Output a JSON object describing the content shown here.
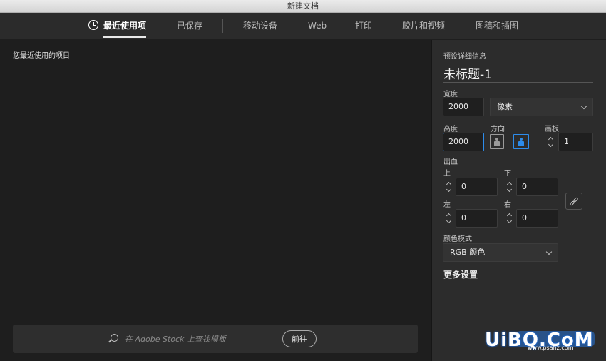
{
  "window": {
    "title": "新建文档"
  },
  "tabs": [
    {
      "label": "最近使用项",
      "active": true
    },
    {
      "label": "已保存"
    },
    {
      "label": "移动设备"
    },
    {
      "label": "Web"
    },
    {
      "label": "打印"
    },
    {
      "label": "胶片和视频"
    },
    {
      "label": "图稿和插图"
    }
  ],
  "recent": {
    "title": "您最近使用的项目"
  },
  "search": {
    "placeholder": "在 Adobe Stock 上查找模板",
    "go_label": "前往"
  },
  "preset": {
    "section_label": "预设详细信息",
    "name": "未标题-1",
    "width_label": "宽度",
    "width_value": "2000",
    "unit": "像素",
    "height_label": "高度",
    "height_value": "2000",
    "orientation_label": "方向",
    "orientation": "landscape",
    "artboard_label": "画板",
    "artboard_value": "1",
    "bleed_label": "出血",
    "bleed": {
      "top_label": "上",
      "top_value": "0",
      "bottom_label": "下",
      "bottom_value": "0",
      "left_label": "左",
      "left_value": "0",
      "right_label": "右",
      "right_value": "0"
    },
    "color_mode_label": "颜色模式",
    "color_mode": "RGB 颜色",
    "more_settings_label": "更多设置"
  },
  "watermark": {
    "text": "UiBQ.CoM",
    "sub": "www.psahz.com"
  },
  "colors": {
    "accent": "#2d8ceb",
    "panel": "#2c2c2c",
    "background": "#1e1e1e"
  }
}
